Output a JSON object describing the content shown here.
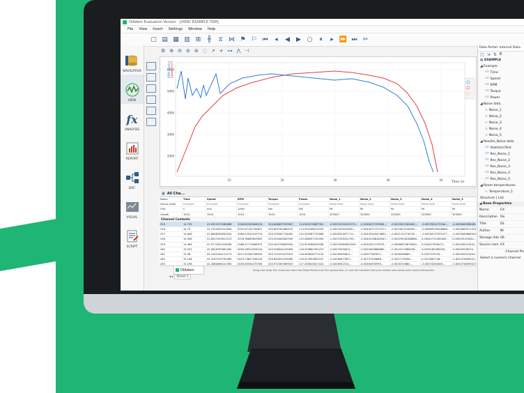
{
  "window": {
    "title": "DIAdem Evaluation Version - [VIEW: EXAMPLE.TDM]"
  },
  "menu": [
    "File",
    "View",
    "Insert",
    "Settings",
    "Window",
    "Help"
  ],
  "nav": [
    "NAVIGATOR",
    "VIEW",
    "ANALYSIS",
    "REPORT",
    "DAC",
    "VISUAL",
    "SCRIPT"
  ],
  "chart": {
    "y_ticks": [
      "6000",
      "5000",
      "4000",
      "3000",
      "2000"
    ],
    "x_ticks": [
      "10",
      "20",
      "30",
      "40",
      "50"
    ],
    "x_unit": "Time (s)",
    "ylabel_blue": "RPM (1/min)",
    "ylabel_red": "Speed (m/s)",
    "colors": {
      "blue": "#2f7bd0",
      "red": "#e53b3b"
    }
  },
  "table": {
    "title": "All Cha...",
    "header_rows": [
      [
        "Name",
        "Time",
        "Speed",
        "RPM",
        "Torque",
        "Power",
        "Noise_1",
        "Noise_2",
        "Noise_3",
        "Noise_4",
        "Noise_5"
      ],
      [
        "Group name",
        "Example",
        "Example",
        "Example",
        "Example",
        "Example",
        "Noise data",
        "Noise data",
        "Noise data",
        "Noise data",
        "Noise data"
      ],
      [
        "Unit",
        "s",
        "m/s",
        "1/min",
        "Nm",
        "kW",
        "Pa",
        "Pa",
        "Pa",
        "Pa",
        "Pa"
      ],
      [
        "Length",
        "1024",
        "1024",
        "1024",
        "1024",
        "1024",
        "325000",
        "325000",
        "325000",
        "325000",
        "325000"
      ]
    ],
    "section_label": "Channel Contents",
    "rows": [
      [
        "255",
        "14.732",
        "41.6323371986866",
        "5348.82345608224",
        "204.848697959967",
        "114.565276867302",
        "-0.00222030243175...",
        "-0.0160875799064...",
        "-0.0020422284649...",
        "-0.0057624179944...",
        "-0.00060809684615..."
      ],
      [
        "256",
        "14.79",
        "41.7204035221806",
        "5352.67145749627",
        "205.800761680072",
        "114.900168019259",
        "-0.0021676234831...",
        "-0.00449717271577...",
        "-0.0015615198094...",
        "-0.00669594558666...",
        "-0.00006645715147..."
      ],
      [
        "257",
        "14.848",
        "41.8068328550424",
        "5364.52022019774",
        "205.255587726402",
        "115.250587729568",
        "-0.0028223077711...",
        "-0.00425264074661...",
        "-0.0021223718792...",
        "-0.00328737201477...",
        "-0.00000608669015..."
      ],
      [
        "258",
        "14.906",
        "41.8927429611213",
        "5376.36665829653",
        "205.305463630939",
        "115.586457192004",
        "-0.0037326252795...",
        "-0.00402168164347...",
        "-0.00329548186866...",
        "0.00042715183405...",
        "0.000055154542..."
      ],
      [
        "259",
        "14.964",
        "41.9772391416928",
        "5388.21713698973",
        "205.449738699943",
        "115.925566092936",
        "-0.00229980482296...",
        "-0.0032207133975...",
        "-0.00686323676540...",
        "0.000427496472...",
        "-0.000185013491..."
      ],
      [
        "260",
        "15.022",
        "42.0618767861362",
        "5400.06510428144",
        "205.508044129999",
        "116.259861991473",
        "-0.00279490521...",
        "-0.0029449868860...",
        "-0.0015313386208...",
        "0.0093185385009...",
        "-0.00009538125..."
      ],
      [
        "261",
        "15.08",
        "42.1442344111274",
        "5411.91264708903",
        "205.722253129919",
        "116.589828771154",
        "-0.00164594611...",
        "-0.00077367611...",
        "-0.0038266889...",
        "0.0037379130...",
        "-0.000095515454..."
      ],
      [
        "262",
        "15.138",
        "42.2267103750465",
        "5423.75827938105",
        "205.850093199989",
        "116.917653852167",
        "-0.00260677827...",
        "-0.00737394866...",
        "-0.0027178306...",
        "0.0013867748...",
        "-2.825374609002..."
      ],
      [
        "263",
        "15.196",
        "42.3088466222390",
        "5435.60534279783",
        "205.972367689923",
        "117.243615817414",
        "-0.0028942314...",
        "-0.00464935993...",
        "-0.0016743882...",
        "-0.00074361846...",
        "-2.8252746090027..."
      ],
      [
        "264",
        "15.254",
        "42.3903012528317",
        "5447.44890795098",
        "206.088035889982",
        "117.566425803598",
        "-0.0011420187...",
        "-0.00907658774...",
        "-0.0016146884...",
        "-0.0025555019...",
        "-0.0000645757514..."
      ],
      [
        "265",
        "15.312",
        "42.4715167994669",
        "5459.28879126186",
        "206.199042249982",
        "117.883320443972",
        "-0.0058433276...",
        "-0.00979362094...",
        "-0.0019638897...",
        "-0.0061122768...",
        "0.0001108321770..."
      ],
      [
        "266",
        "15.37",
        "42.5522065331831",
        "5471.12459693731",
        "206.304730630033",
        "118.199150953159",
        "-0.0038746048...",
        "-0.00558301174...",
        "-0.0047416372...",
        "-0.00346560273...",
        "-0.0012494970081..."
      ]
    ],
    "drop_message": "Drag and drop the channels from the Data Portal into the worksheet, or use the context menu to create new areas and control elements.",
    "tab_label": "DIAdem",
    "sheet_label": "Sheet 1"
  },
  "portal": {
    "title": "Data Portal: Internal Data",
    "file": "EXAMPLE",
    "group_example": "Example",
    "example_channels": [
      "Time",
      "Speed",
      "RPM",
      "Torque",
      "Power"
    ],
    "group_noise": "Noise data",
    "noise_channels": [
      "Noise_1",
      "Noise_2",
      "Noise_3",
      "Noise_4",
      "Noise_5"
    ],
    "group_results": "Results_Noise data",
    "result_channels": [
      "StatisticsText",
      "Res_Noise_1",
      "Res_Noise_2",
      "Res_Noise_3",
      "Res_Noise_4",
      "Res_Noise_5"
    ],
    "group_room": "Room temperatures",
    "room_channels": [
      "Temperature_1"
    ],
    "tabs": "Structure | List",
    "props_title": "Base Properties",
    "props": [
      [
        "Name",
        "EX"
      ],
      [
        "Description",
        "De"
      ],
      [
        "Title",
        "DL"
      ],
      [
        "Author",
        "NI"
      ],
      [
        "Storage date/time",
        "06"
      ],
      [
        "Source name",
        "EX"
      ]
    ],
    "footer1": "Channel Pro",
    "footer2": "Select a numeric channel"
  }
}
